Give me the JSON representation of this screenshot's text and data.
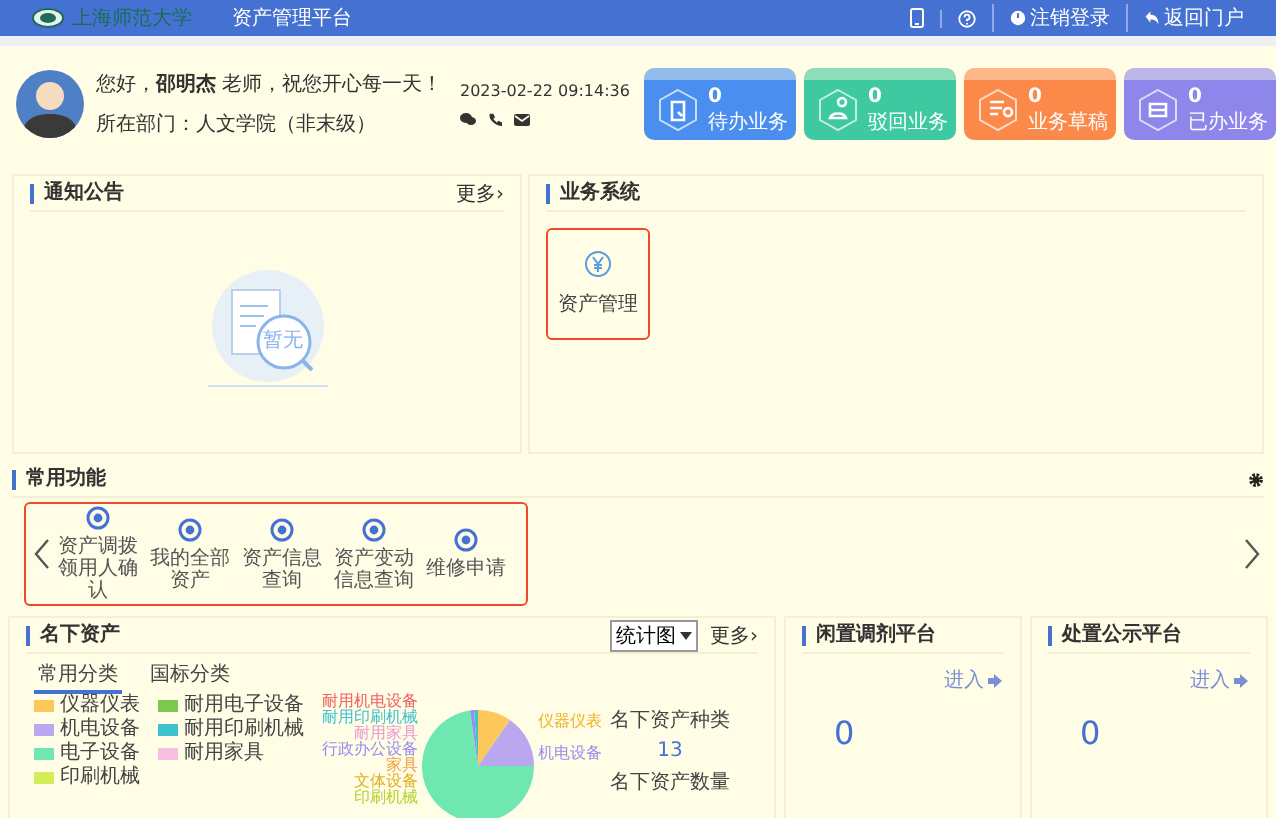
{
  "header": {
    "logo_text": "上海师范大学",
    "title": "资产管理平台",
    "actions": [
      {
        "kind": "phone"
      },
      {
        "kind": "help"
      },
      {
        "kind": "logout",
        "label": "注销登录"
      },
      {
        "kind": "back",
        "label": "返回门户"
      }
    ]
  },
  "profile": {
    "greeting": "您好，**邵明杰** 老师，祝您开心每一天！",
    "datetime": "2023-02-22 09:14:36",
    "department": "所在部门：人文学院（非末级）",
    "contacts": [
      {
        "kind": "wechat"
      },
      {
        "kind": "phone"
      },
      {
        "kind": "mail"
      }
    ]
  },
  "stat_cards": [
    {
      "kind": "todo",
      "count": "0",
      "label": "待办业务",
      "color": "#4a8ff0"
    },
    {
      "kind": "rejected",
      "count": "0",
      "label": "驳回业务",
      "color": "#3ec9a0"
    },
    {
      "kind": "draft",
      "count": "0",
      "label": "业务草稿",
      "color": "#fb8a4a"
    },
    {
      "kind": "done",
      "count": "0",
      "label": "已办业务",
      "color": "#8e86ea"
    }
  ],
  "notice": {
    "title": "通知公告",
    "more": "更多›",
    "empty_text": "暂无"
  },
  "business_system": {
    "title": "业务系统",
    "items": [
      {
        "label": "资产管理",
        "selected": true
      }
    ]
  },
  "common_functions": {
    "title": "常用功能",
    "items": [
      {
        "label": "资产调拨领用人确认"
      },
      {
        "label": "我的全部资产"
      },
      {
        "label": "资产信息查询"
      },
      {
        "label": "资产变动信息查询"
      },
      {
        "label": "维修申请"
      }
    ]
  },
  "my_assets": {
    "title": "名下资产",
    "view_select": "统计图",
    "more": "更多›",
    "tabs": [
      {
        "label": "常用分类",
        "selected": true
      },
      {
        "label": "国标分类",
        "selected": false
      }
    ],
    "legend": [
      {
        "label": "仪器仪表",
        "color": "#fcc85a"
      },
      {
        "label": "耐用电子设备",
        "color": "#7cc84e"
      },
      {
        "label": "机电设备",
        "color": "#b9a8f0"
      },
      {
        "label": "耐用印刷机械",
        "color": "#3fc2d0"
      },
      {
        "label": "电子设备",
        "color": "#6ee8b0"
      },
      {
        "label": "耐用家具",
        "color": "#f8bfe0"
      },
      {
        "label": "印刷机械",
        "color": "#d4ee5a"
      }
    ],
    "slice_labels_left": [
      {
        "label": "耐用机电设备",
        "color": "#f06060"
      },
      {
        "label": "耐用印刷机械",
        "color": "#3fc2d0"
      },
      {
        "label": "耐用家具",
        "color": "#e89ad0"
      },
      {
        "label": "行政办公设备",
        "color": "#9a8cf0"
      },
      {
        "label": "家具",
        "color": "#f0a040"
      },
      {
        "label": "文体设备",
        "color": "#e0b020"
      },
      {
        "label": "印刷机械",
        "color": "#b8d030"
      }
    ],
    "slice_labels_right": [
      {
        "label": "仪器仪表",
        "color": "#f0b020"
      },
      {
        "label": "机电设备",
        "color": "#9a8cf0"
      }
    ],
    "stats": [
      {
        "label": "名下资产种类",
        "value": "13"
      },
      {
        "label": "名下资产数量"
      }
    ]
  },
  "platforms": [
    {
      "title": "闲置调剂平台",
      "enter": "进入",
      "count": "0"
    },
    {
      "title": "处置公示平台",
      "enter": "进入",
      "count": "0"
    }
  ]
}
